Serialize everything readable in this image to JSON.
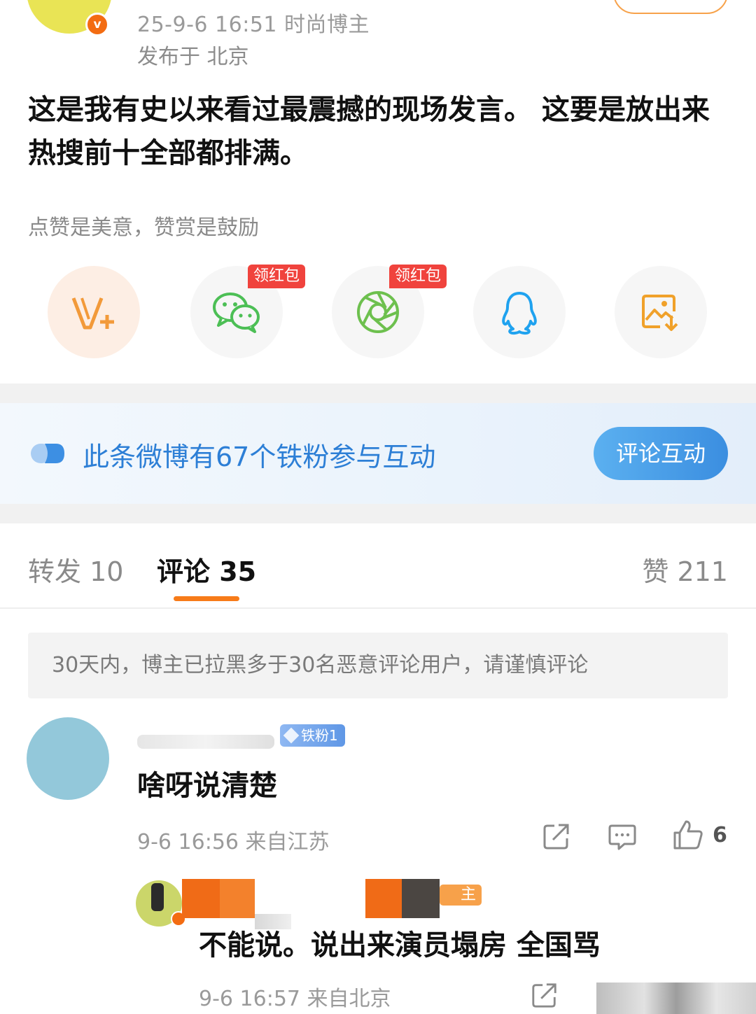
{
  "post": {
    "meta_line": "25-9-6 16:51  时尚博主",
    "location": "发布于 北京",
    "text": "这是我有史以来看过最震撼的现场发言。 这要是放出来热搜前十全部都排满。",
    "tip": "点赞是美意，赞赏是鼓励"
  },
  "share": {
    "red_tag_1": "领红包",
    "red_tag_2": "领红包",
    "icons": [
      "vplus-icon",
      "wechat-icon",
      "moments-icon",
      "qq-icon",
      "save-image-icon"
    ]
  },
  "fans_banner": {
    "text": "此条微博有67个铁粉参与互动",
    "button": "评论互动"
  },
  "tabs": {
    "repost": "转发 10",
    "comment": "评论 35",
    "like": "赞 211"
  },
  "notice": "30天内，博主已拉黑多于30名恶意评论用户，请谨慎评论",
  "comment": {
    "fan_badge": "铁粉1",
    "text": "啥呀说清楚",
    "meta": "9-6 16:56  来自江苏",
    "like_count": "6"
  },
  "reply": {
    "badge": "主",
    "text": "不能说。说出来演员塌房 全国骂",
    "meta": "9-6 16:57  来自北京"
  },
  "colors": {
    "accent_orange": "#f77b19",
    "link_blue": "#2d7fd6",
    "red_tag": "#f0433d"
  }
}
